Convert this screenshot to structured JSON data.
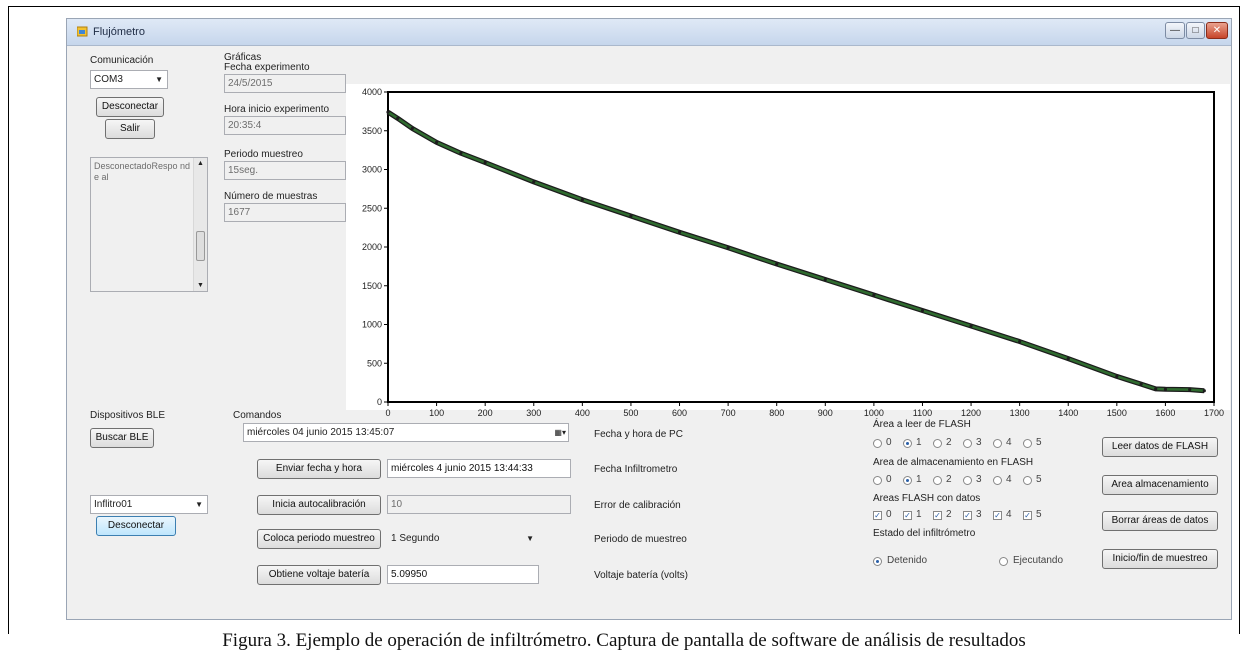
{
  "window": {
    "title": "Flujómetro",
    "controls": {
      "minimize": "—",
      "maximize": "□",
      "close": "✕"
    }
  },
  "comunicacion": {
    "group_label": "Comunicación",
    "port_value": "COM3",
    "disconnect_label": "Desconectar",
    "exit_label": "Salir",
    "log_text": "DesconectadoRespo nde al"
  },
  "graficas": {
    "group_label": "Gráficas",
    "fecha_label": "Fecha experimento",
    "fecha_value": "24/5/2015",
    "hora_label": "Hora inicio experimento",
    "hora_value": "20:35:4",
    "periodo_label": "Periodo muestreo",
    "periodo_value": "15seg.",
    "numero_label": "Número de muestras",
    "numero_value": "1677"
  },
  "chart_data": {
    "type": "line",
    "title": "",
    "xlabel": "",
    "ylabel": "",
    "xlim": [
      0,
      1700
    ],
    "ylim": [
      0,
      4000
    ],
    "xticks": [
      0,
      100,
      200,
      300,
      400,
      500,
      600,
      700,
      800,
      900,
      1000,
      1100,
      1200,
      1300,
      1400,
      1500,
      1600,
      1700
    ],
    "yticks": [
      0,
      500,
      1000,
      1500,
      2000,
      2500,
      3000,
      3500,
      4000
    ],
    "grid": false,
    "series": [
      {
        "color": "#2f6b2f",
        "x": [
          0,
          20,
          50,
          100,
          150,
          200,
          300,
          400,
          500,
          600,
          700,
          800,
          900,
          1000,
          1100,
          1200,
          1300,
          1400,
          1500,
          1550,
          1580,
          1600,
          1650,
          1680
        ],
        "y": [
          3740,
          3660,
          3530,
          3350,
          3210,
          3090,
          2840,
          2610,
          2400,
          2190,
          1990,
          1780,
          1580,
          1380,
          1180,
          980,
          780,
          560,
          330,
          230,
          170,
          165,
          160,
          145
        ]
      }
    ]
  },
  "ble": {
    "group_label": "Dispositivos BLE",
    "search_label": "Buscar BLE",
    "device_value": "Inflitro01",
    "disconnect_label": "Desconectar"
  },
  "comandos": {
    "group_label": "Comandos",
    "datetime_value": "miércoles  04     junio      2015 13:45:07",
    "pc_label": "Fecha y hora de PC",
    "send_label": "Enviar fecha y hora",
    "send_value": "miércoles 4 junio 2015 13:44:33",
    "infil_label": "Fecha Infiltrometro",
    "calib_label": "Inicia autocalibración",
    "calib_value": "10",
    "calib_desc": "Error de calibración",
    "periodo_btn_label": "Coloca periodo muestreo",
    "periodo_value": "1 Segundo",
    "periodo_desc": "Periodo de muestreo",
    "bateria_label": "Obtiene voltaje batería",
    "bateria_value": "5.09950",
    "bateria_desc": "Voltaje batería (volts)"
  },
  "flash": {
    "leer_label": "Área a leer de FLASH",
    "almac_label": "Area de almacenamiento en FLASH",
    "datos_label": "Areas FLASH con datos",
    "options": [
      "0",
      "1",
      "2",
      "3",
      "4",
      "5"
    ],
    "leer_selected": "1",
    "almac_selected": "1",
    "estado_label": "Estado del infiltrómetro",
    "estado_options": [
      "Detenido",
      "Ejecutando"
    ],
    "estado_selected": "Detenido",
    "btn_leer": "Leer datos de FLASH",
    "btn_almac": "Area almacenamiento",
    "btn_borrar": "Borrar áreas de datos",
    "btn_inicio": "Inicio/fin de muestreo"
  },
  "caption": "Figura 3.  Ejemplo de operación de infiltrómetro. Captura de pantalla de software de análisis de resultados"
}
